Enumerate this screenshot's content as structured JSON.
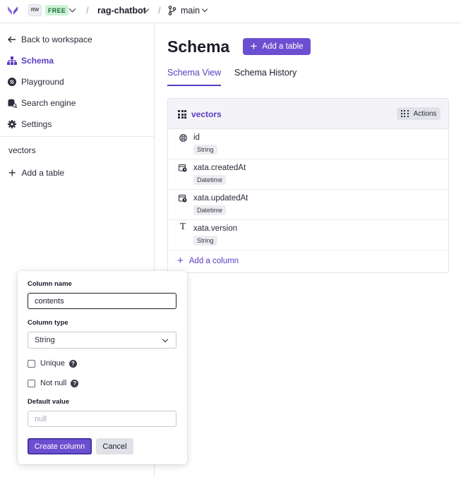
{
  "topbar": {
    "workspace_initials": "RW",
    "plan": "FREE",
    "separator": "/",
    "database": "rag-chatbot",
    "branch": "main"
  },
  "sidebar": {
    "back": "Back to workspace",
    "items": [
      {
        "label": "Schema",
        "icon": "schema-icon",
        "active": true
      },
      {
        "label": "Playground",
        "icon": "playground-icon",
        "active": false
      },
      {
        "label": "Search engine",
        "icon": "database-search-icon",
        "active": false
      },
      {
        "label": "Settings",
        "icon": "gear-icon",
        "active": false
      }
    ],
    "tables": [
      "vectors"
    ],
    "add_table": "Add a table"
  },
  "main": {
    "title": "Schema",
    "add_table_button": "Add a table",
    "tabs": [
      {
        "label": "Schema View",
        "active": true
      },
      {
        "label": "Schema History",
        "active": false
      }
    ],
    "table": {
      "name": "vectors",
      "actions": "Actions",
      "columns": [
        {
          "name": "id",
          "type": "String",
          "icon": "id-icon"
        },
        {
          "name": "xata.createdAt",
          "type": "Datetime",
          "icon": "calendar-clock-icon"
        },
        {
          "name": "xata.updatedAt",
          "type": "Datetime",
          "icon": "calendar-clock-icon"
        },
        {
          "name": "xata.version",
          "type": "String",
          "icon": "text-type-icon"
        }
      ],
      "add_column": "Add a column"
    }
  },
  "popover": {
    "column_name_label": "Column name",
    "column_name_value": "contents",
    "column_type_label": "Column type",
    "column_type_value": "String",
    "unique_label": "Unique",
    "not_null_label": "Not null",
    "default_value_label": "Default value",
    "default_value_placeholder": "null",
    "create_button": "Create column",
    "cancel_button": "Cancel"
  },
  "colors": {
    "accent": "#6b4fd0",
    "accent_text": "#5a3cc4",
    "free_badge_bg": "#cdf3d7"
  }
}
